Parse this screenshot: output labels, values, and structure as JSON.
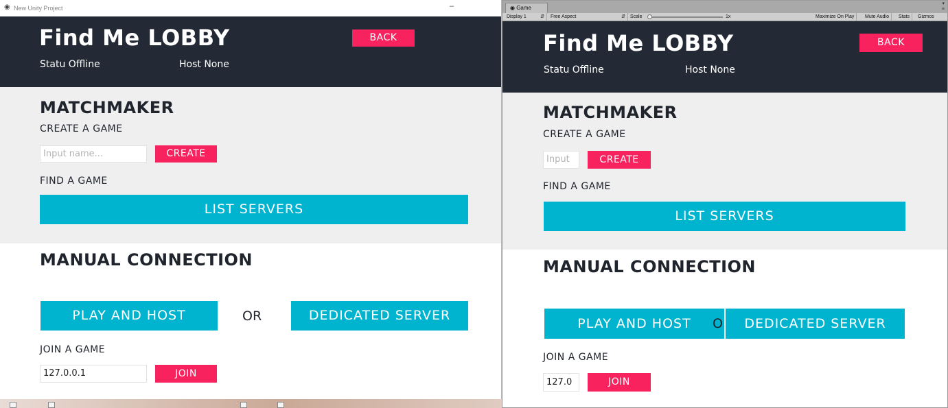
{
  "left_window": {
    "title": "New Unity Project",
    "minimize_glyph": "–"
  },
  "editor": {
    "tab_label": "Game",
    "toolbar": {
      "display": "Display 1",
      "aspect": "Free Aspect",
      "scale_label": "Scale",
      "scale_value": "1x",
      "maximize_on_play": "Maximize On Play",
      "mute_audio": "Mute Audio",
      "stats": "Stats",
      "gizmos": "Gizmos"
    }
  },
  "lobby": {
    "title": "Find Me LOBBY",
    "back_label": "BACK",
    "status_text": "Statu Offline",
    "host_text": "Host None",
    "matchmaker_heading": "MATCHMAKER",
    "create_game_heading": "CREATE A GAME",
    "name_input_placeholder_left": "Input name...",
    "name_input_placeholder_right": "Input",
    "create_label": "CREATE",
    "find_game_heading": "FIND A GAME",
    "list_servers_label": "LIST SERVERS",
    "manual_heading": "MANUAL CONNECTION",
    "play_host_label": "PLAY AND HOST",
    "or_label": "OR",
    "or_label_clipped": "O",
    "dedicated_label": "DEDICATED SERVER",
    "join_game_heading": "JOIN A GAME",
    "ip_value_left": "127.0.0.1",
    "ip_value_right": "127.0",
    "join_label": "JOIN"
  },
  "colors": {
    "header_bg": "#242a35",
    "accent_pink": "#f8225e",
    "accent_cyan": "#00b4cf",
    "section_light": "#efefef"
  }
}
